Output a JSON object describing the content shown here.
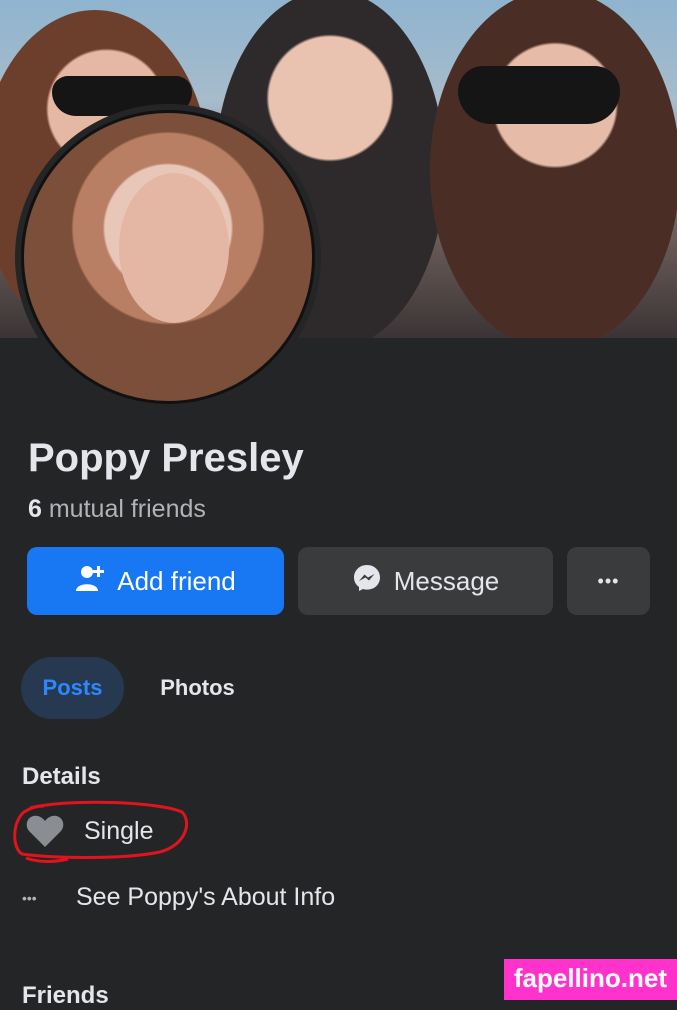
{
  "profile": {
    "name": "Poppy Presley",
    "mutual_count": "6",
    "mutual_label": "mutual friends"
  },
  "actions": {
    "add_friend_label": "Add friend",
    "message_label": "Message",
    "more_glyph": "•••"
  },
  "tabs": [
    {
      "label": "Posts",
      "active": true
    },
    {
      "label": "Photos",
      "active": false
    }
  ],
  "details": {
    "heading": "Details",
    "relationship": "Single",
    "about_link": "See Poppy's About Info",
    "more_glyph": "•••"
  },
  "friends": {
    "heading": "Friends"
  },
  "watermark": "fapellino.net",
  "icons": {
    "add_friend": "person-plus-icon",
    "message": "messenger-icon",
    "more": "ellipsis-icon",
    "relationship": "heart-icon",
    "about": "ellipsis-icon"
  },
  "colors": {
    "background": "#242526",
    "primary": "#1877f2",
    "secondary_button": "#3a3b3c",
    "active_tab_bg": "#263951",
    "active_tab_text": "#2d88ff",
    "annotation": "#e0141e",
    "watermark_bg": "#ff33cc"
  }
}
